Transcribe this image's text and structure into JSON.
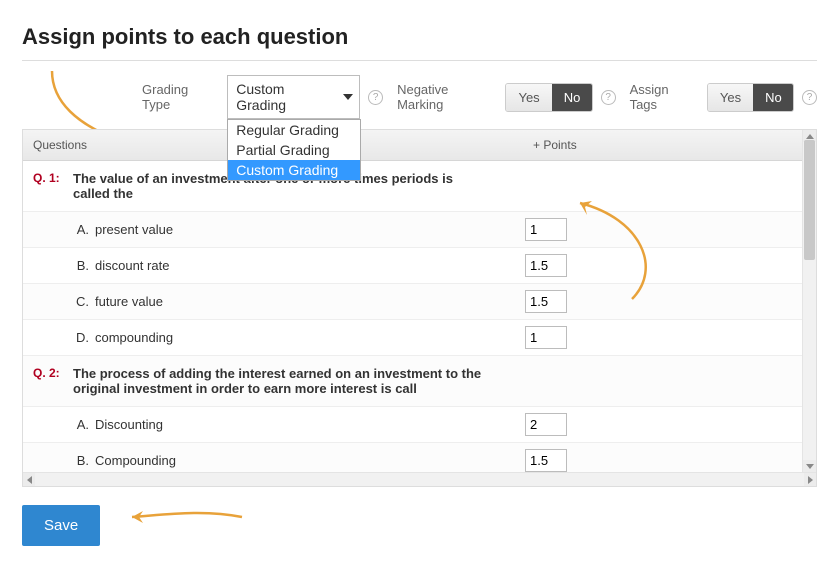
{
  "page_title": "Assign points to each question",
  "toolbar": {
    "grading_type_label": "Grading Type",
    "grading_type_value": "Custom Grading",
    "grading_type_options": {
      "o0": "Regular Grading",
      "o1": "Partial Grading",
      "o2": "Custom Grading"
    },
    "negative_marking_label": "Negative Marking",
    "negative_marking_yes": "Yes",
    "negative_marking_no": "No",
    "negative_marking_value": "No",
    "assign_tags_label": "Assign Tags",
    "assign_tags_yes": "Yes",
    "assign_tags_no": "No",
    "assign_tags_value": "No"
  },
  "table": {
    "header_questions": "Questions",
    "header_points": "+ Points"
  },
  "questions": {
    "q1": {
      "num": "Q. 1:",
      "text": "The value of an investment after one or more times periods is called the",
      "a_letter": "A.",
      "a_text": "present value",
      "a_points": "1",
      "b_letter": "B.",
      "b_text": "discount rate",
      "b_points": "1.5",
      "c_letter": "C.",
      "c_text": "future value",
      "c_points": "1.5",
      "d_letter": "D.",
      "d_text": "compounding",
      "d_points": "1"
    },
    "q2": {
      "num": "Q. 2:",
      "text": "The process of adding the interest earned on an investment to the original investment in order to earn more interest is call",
      "a_letter": "A.",
      "a_text": "Discounting",
      "a_points": "2",
      "b_letter": "B.",
      "b_text": "Compounding",
      "b_points": "1.5"
    }
  },
  "save_label": "Save"
}
